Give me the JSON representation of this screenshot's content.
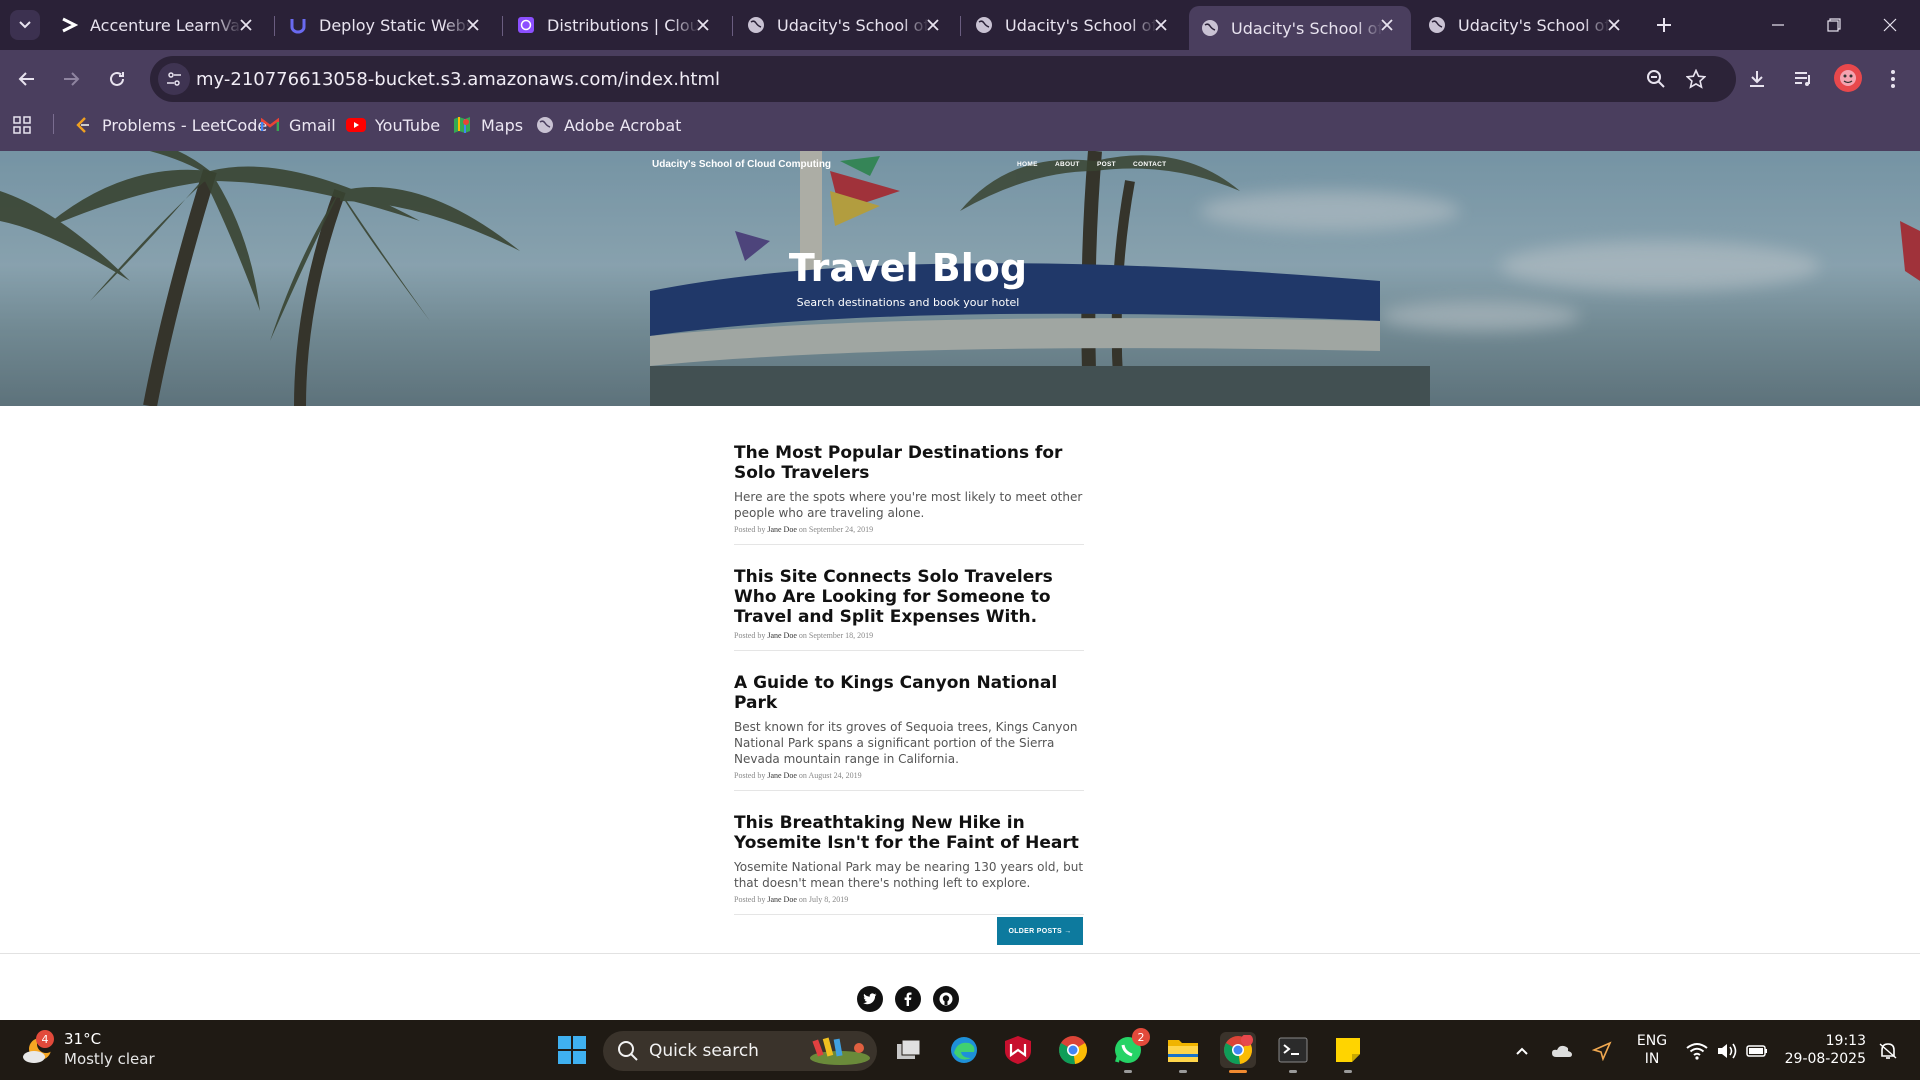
{
  "browser": {
    "tabs": [
      {
        "title": "Accenture LearnVantage",
        "active": false
      },
      {
        "title": "Deploy Static Website",
        "active": false
      },
      {
        "title": "Distributions | CloudFront",
        "active": false
      },
      {
        "title": "Udacity's School of Cloud",
        "active": false
      },
      {
        "title": "Udacity's School of Cloud",
        "active": false
      },
      {
        "title": "Udacity's School of Cloud",
        "active": true
      },
      {
        "title": "Udacity's School of Cloud",
        "active": false
      }
    ],
    "url": "my-210776613058-bucket.s3.amazonaws.com/index.html",
    "bookmarks": [
      {
        "label": "Problems - LeetCode",
        "icon": "leetcode-icon"
      },
      {
        "label": "Gmail",
        "icon": "gmail-icon"
      },
      {
        "label": "YouTube",
        "icon": "youtube-icon"
      },
      {
        "label": "Maps",
        "icon": "maps-icon"
      },
      {
        "label": "Adobe Acrobat",
        "icon": "globe-icon"
      }
    ]
  },
  "site": {
    "brand": "Udacity's School of Cloud Computing",
    "nav": [
      "HOME",
      "ABOUT",
      "POST",
      "CONTACT"
    ],
    "hero_title": "Travel Blog",
    "hero_subtitle": "Search destinations and book your hotel",
    "posts": [
      {
        "title": "The Most Popular Destinations for Solo Travelers",
        "subtitle": "Here are the spots where you're most likely to meet other people who are traveling alone.",
        "meta_prefix": "Posted by ",
        "author": "Jane Doe",
        "meta_suffix": " on September 24, 2019"
      },
      {
        "title": "This Site Connects Solo Travelers Who Are Looking for Someone to Travel and Split Expenses With.",
        "subtitle": "",
        "meta_prefix": "Posted by ",
        "author": "Jane Doe",
        "meta_suffix": " on September 18, 2019"
      },
      {
        "title": "A Guide to Kings Canyon National Park",
        "subtitle": "Best known for its groves of Sequoia trees, Kings Canyon National Park spans a significant portion of the Sierra Nevada mountain range in California.",
        "meta_prefix": "Posted by ",
        "author": "Jane Doe",
        "meta_suffix": " on August 24, 2019"
      },
      {
        "title": "This Breathtaking New Hike in Yosemite Isn't for the Faint of Heart",
        "subtitle": "Yosemite National Park may be nearing 130 years old, but that doesn't mean there's nothing left to explore.",
        "meta_prefix": "Posted by ",
        "author": "Jane Doe",
        "meta_suffix": " on July 8, 2019"
      }
    ],
    "older_posts": "OLDER POSTS →"
  },
  "taskbar": {
    "weather_temp": "31°C",
    "weather_desc": "Mostly clear",
    "weather_badge": "4",
    "search_label": "Quick search",
    "whatsapp_badge": "2",
    "lang_line1": "ENG",
    "lang_line2": "IN",
    "time": "19:13",
    "date": "29-08-2025"
  },
  "colors": {
    "chrome_dark": "#2a2137",
    "chrome_toolbar": "#4a3e5e",
    "older_button": "#0d7a9e"
  }
}
